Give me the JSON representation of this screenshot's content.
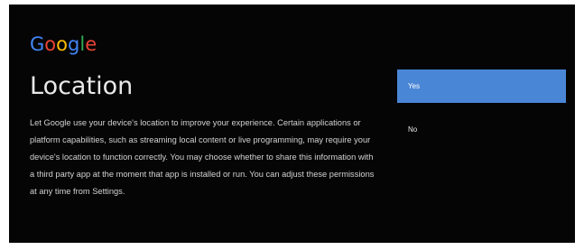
{
  "logo": {
    "letters": [
      {
        "char": "G",
        "color": "#4285F4"
      },
      {
        "char": "o",
        "color": "#EA4335"
      },
      {
        "char": "o",
        "color": "#FBBC05"
      },
      {
        "char": "g",
        "color": "#4285F4"
      },
      {
        "char": "l",
        "color": "#34A853"
      },
      {
        "char": "e",
        "color": "#EA4335"
      }
    ]
  },
  "page": {
    "title": "Location",
    "description": "Let Google use your device's location to improve your experience. Certain applications or platform capabilities, such as streaming local content or live programming, may require your device's location to function correctly. You may choose whether to share this information with a third party app at the moment that app is installed or run. You can adjust these permissions at any time from Settings."
  },
  "options": [
    {
      "label": "Yes",
      "selected": true
    },
    {
      "label": "No",
      "selected": false
    }
  ],
  "colors": {
    "background": "#050505",
    "accent": "#4A86D6",
    "text": "#E9E9E9"
  }
}
